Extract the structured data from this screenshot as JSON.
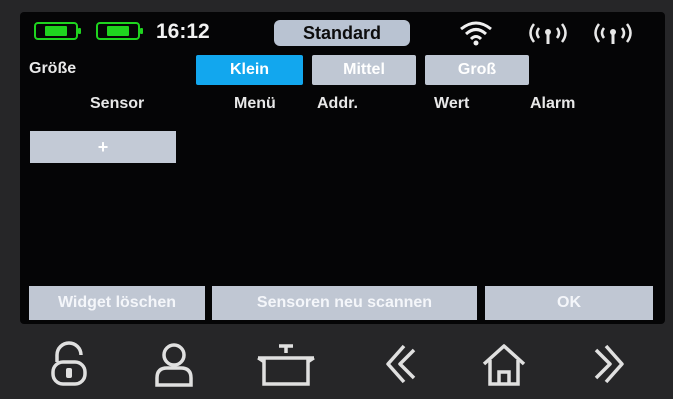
{
  "status_bar": {
    "time": "16:12",
    "profile": "Standard",
    "icons": [
      "battery-icon",
      "battery-icon",
      "wifi-icon",
      "radio-signal-icon",
      "radio-signal-icon"
    ],
    "accent_color": "#1fd41f"
  },
  "size_row": {
    "label": "Größe",
    "options": [
      "Klein",
      "Mittel",
      "Groß"
    ],
    "selected": "Klein",
    "active_color": "#12a7ee"
  },
  "columns": [
    "Sensor",
    "Menü",
    "Addr.",
    "Wert",
    "Alarm"
  ],
  "add_button": "+",
  "actions": {
    "delete_widget": "Widget löschen",
    "rescan_sensors": "Sensoren neu scannen",
    "ok": "OK"
  },
  "nav_icons": [
    "unlock-icon",
    "user-icon",
    "pot-icon",
    "back-icon",
    "home-icon",
    "forward-icon"
  ]
}
